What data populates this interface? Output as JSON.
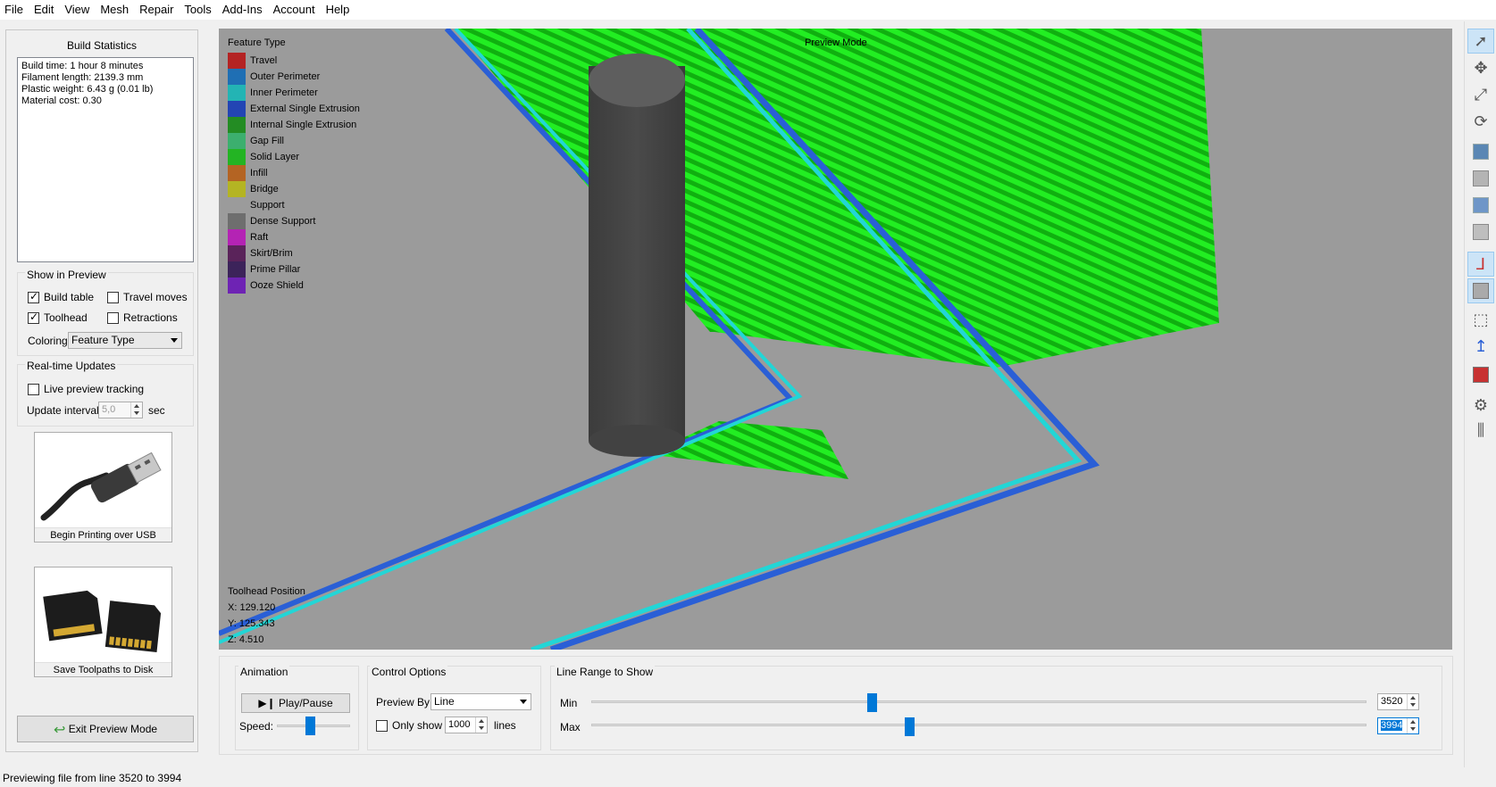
{
  "menu": [
    "File",
    "Edit",
    "View",
    "Mesh",
    "Repair",
    "Tools",
    "Add-Ins",
    "Account",
    "Help"
  ],
  "left": {
    "build_stats_title": "Build Statistics",
    "stats": [
      "Build time: 1 hour 8 minutes",
      "Filament length: 2139.3 mm",
      "Plastic weight: 6.43 g (0.01 lb)",
      "Material cost: 0.30"
    ],
    "show_title": "Show in Preview",
    "build_table": "Build table",
    "travel_moves": "Travel moves",
    "toolhead": "Toolhead",
    "retractions": "Retractions",
    "coloring_label": "Coloring",
    "coloring_value": "Feature Type",
    "realtime_title": "Real-time Updates",
    "live_preview": "Live preview tracking",
    "update_interval_label": "Update interval",
    "update_interval_value": "5,0",
    "sec": "sec",
    "usb_button": "Begin Printing over USB",
    "disk_button": "Save Toolpaths to Disk",
    "exit_button": "Exit Preview Mode"
  },
  "viewport": {
    "legend_title": "Feature Type",
    "legend": [
      {
        "label": "Travel",
        "color": "#b42323"
      },
      {
        "label": "Outer Perimeter",
        "color": "#1f6fb4"
      },
      {
        "label": "Inner Perimeter",
        "color": "#23b4b4"
      },
      {
        "label": "External Single Extrusion",
        "color": "#2345b4"
      },
      {
        "label": "Internal Single Extrusion",
        "color": "#238c23"
      },
      {
        "label": "Gap Fill",
        "color": "#3caf6e"
      },
      {
        "label": "Solid Layer",
        "color": "#23b423"
      },
      {
        "label": "Infill",
        "color": "#b46423"
      },
      {
        "label": "Bridge",
        "color": "#b4b423"
      },
      {
        "label": "Support",
        "color": "#9b9b9b"
      },
      {
        "label": "Dense Support",
        "color": "#6e6e6e"
      },
      {
        "label": "Raft",
        "color": "#b423b4"
      },
      {
        "label": "Skirt/Brim",
        "color": "#5a235a"
      },
      {
        "label": "Prime Pillar",
        "color": "#3c235a"
      },
      {
        "label": "Ooze Shield",
        "color": "#6e23b4"
      }
    ],
    "preview_mode": "Preview Mode",
    "toolhead_title": "Toolhead Position",
    "x": "X: 129.120",
    "y": "Y: 125.343",
    "z": "Z: 4.510"
  },
  "bottom": {
    "animation_title": "Animation",
    "play_pause": "Play/Pause",
    "speed_label": "Speed:",
    "speed_level": 0.45,
    "control_title": "Control Options",
    "preview_by_label": "Preview By",
    "preview_by_value": "Line",
    "only_show_label": "Only show",
    "only_show_value": "1000",
    "lines_label": "lines",
    "range_title": "Line Range to Show",
    "min_label": "Min",
    "max_label": "Max",
    "min_value": "3520",
    "max_value": "3994",
    "min_level": 0.362,
    "max_level": 0.41
  },
  "status": "Previewing file from line 3520 to 3994",
  "toolbar_icons": [
    "select-arrow-icon",
    "move-icon",
    "scale-icon",
    "rotate-icon",
    "view-cube-icon",
    "view-cube-icon",
    "view-cube-icon",
    "view-cube-icon",
    "axis-icon",
    "solid-cube-icon",
    "wireframe-cube-icon",
    "z-axis-icon",
    "section-icon",
    "gear-icon",
    "supports-icon"
  ]
}
